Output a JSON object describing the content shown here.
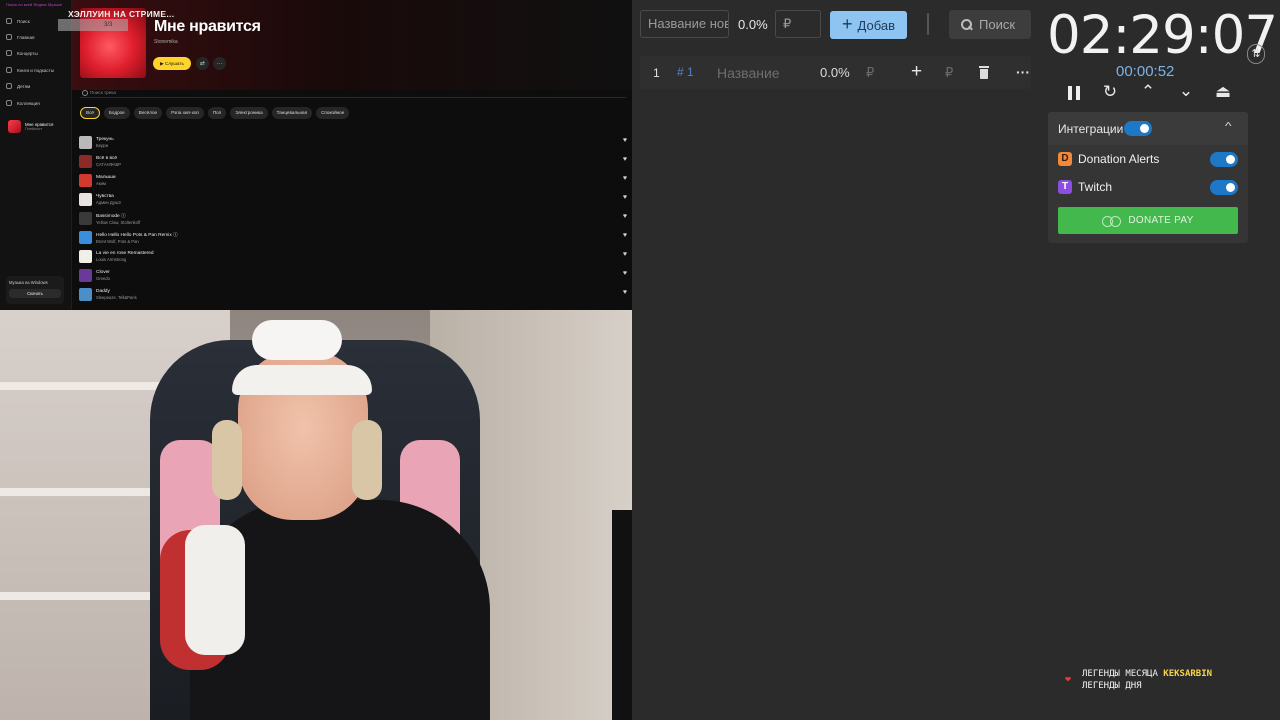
{
  "music_app": {
    "sidebar": {
      "brand": "Поиск по всей Яндекс Музыке",
      "items": [
        {
          "label": "Поиск"
        },
        {
          "label": "Главная"
        },
        {
          "label": "Концерты"
        },
        {
          "label": "Книги и подкасты"
        },
        {
          "label": "Детям"
        },
        {
          "label": "Коллекция"
        }
      ],
      "favorite": {
        "title": "Мне нравится",
        "subtitle": "Плейлист"
      },
      "windows_promo": {
        "text": "Музыка на Windows",
        "button": "Скачать"
      }
    },
    "overlay_title": "ХЭЛЛУИН НА СТРИМЕ...",
    "overlay_tag": "3/3",
    "playlist": {
      "title": "Мне нравится",
      "owner": "Stonemika",
      "listen_button": "▶ Слушать"
    },
    "search_placeholder": "Поиск трека",
    "chips": [
      "Всё",
      "Бодрое",
      "Весёлое",
      "Рэпа хип-хоп",
      "Поп",
      "Электроника",
      "Танцевальная",
      "Спокойное"
    ],
    "tracks": [
      {
        "name": "Трекунь",
        "artist": "Берри",
        "color": "#b9b9b9"
      },
      {
        "name": "Всё в всё",
        "artist": "САТАНФАБР",
        "color": "#8c2a2a"
      },
      {
        "name": "Малыши",
        "artist": "Аким",
        "color": "#d23a2f"
      },
      {
        "name": "Чувства",
        "artist": "Админ ДушЗ",
        "color": "#e8e2e2"
      },
      {
        "name": "Bassimode ⓘ",
        "artist": "Yellow Claw, Stoltenkoff",
        "color": "#3a3a3a"
      },
      {
        "name": "Hello Hello Hello Pots & Pan Remix ⓘ",
        "artist": "Brent Wolf, Pots & Pan",
        "color": "#3b8edb"
      },
      {
        "name": "La vie en rose Remastered",
        "artist": "Louis Armstrong",
        "color": "#f0efe8"
      },
      {
        "name": "Clover",
        "artist": "Greedo",
        "color": "#6a3a9a"
      },
      {
        "name": "Daddy",
        "artist": "Sleepeaze, Tell&Paris",
        "color": "#4a8fc8"
      }
    ]
  },
  "auction": {
    "name_placeholder": "Название нов",
    "percent": "0.0%",
    "amount_placeholder": "₽",
    "add_button": "Добав",
    "search_button": "Поиск",
    "lots": [
      {
        "num": "1",
        "id": "# 1",
        "name_placeholder": "Название",
        "percent": "0.0%",
        "currency": "₽",
        "currency2": "₽"
      }
    ]
  },
  "timer": {
    "main": "02:29:07",
    "sub": "00:00:52"
  },
  "integrations": {
    "title": "Интеграции",
    "items": [
      {
        "label": "Donation Alerts",
        "enabled": true
      },
      {
        "label": "Twitch",
        "enabled": true
      }
    ],
    "donatepay_button": "DONATE PAY"
  },
  "legends": {
    "month_label": "ЛЕГЕНДЫ МЕСЯЦА",
    "month_name": "KEKSARBIN",
    "day_label": "ЛЕГЕНДЫ ДНЯ"
  },
  "colors": {
    "accent_blue": "#8ec4f2",
    "toggle_blue": "#1e78c8",
    "donatepay_green": "#43b84c",
    "yandex_yellow": "#ffd42a"
  }
}
